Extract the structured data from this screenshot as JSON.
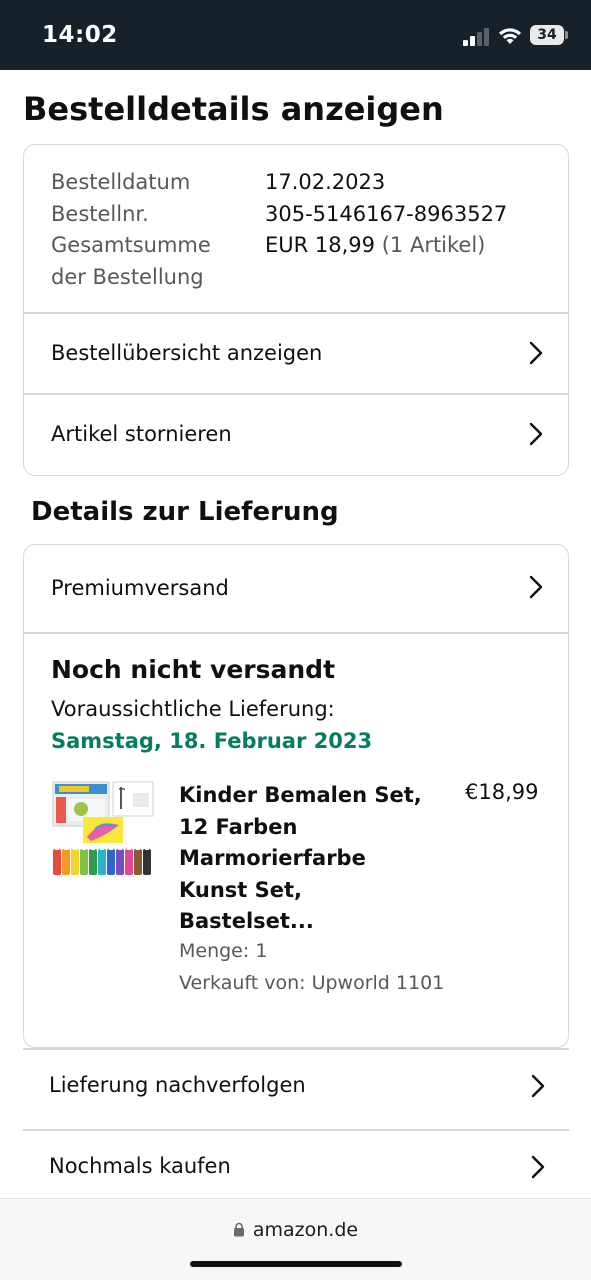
{
  "status_bar": {
    "time": "14:02",
    "battery": "34"
  },
  "page": {
    "title": "Bestelldetails anzeigen"
  },
  "order": {
    "date_label": "Bestelldatum",
    "date_value": "17.02.2023",
    "number_label": "Bestellnr.",
    "number_value": "305-5146167-8963527",
    "total_label_1": "Gesamtsumme",
    "total_label_2": "der Bestellung",
    "total_value": "EUR 18,99",
    "total_items": "(1 Artikel)",
    "summary_link": "Bestellübersicht anzeigen",
    "cancel_link": "Artikel stornieren"
  },
  "delivery": {
    "section_title": "Details zur Lieferung",
    "shipping_method": "Premiumversand",
    "status": "Noch nicht versandt",
    "expected_label": "Voraussichtliche Lieferung:",
    "expected_date": "Samstag, 18. Februar 2023",
    "expected_date_color": "#067d62",
    "product": {
      "title_lines": [
        "Kinder Bemalen Set,",
        "12 Farben",
        "Marmorierfarbe",
        "Kunst Set,",
        "Bastelset..."
      ],
      "price": "€18,99",
      "quantity": "Menge: 1",
      "seller": "Verkauft von: Upworld 1101"
    }
  },
  "actions": {
    "track": "Lieferung nachverfolgen",
    "buy_again": "Nochmals kaufen"
  },
  "browser": {
    "url": "amazon.de"
  },
  "icons": [
    "signal-icon",
    "wifi-icon",
    "battery-icon",
    "chevron-right-icon",
    "lock-icon"
  ]
}
